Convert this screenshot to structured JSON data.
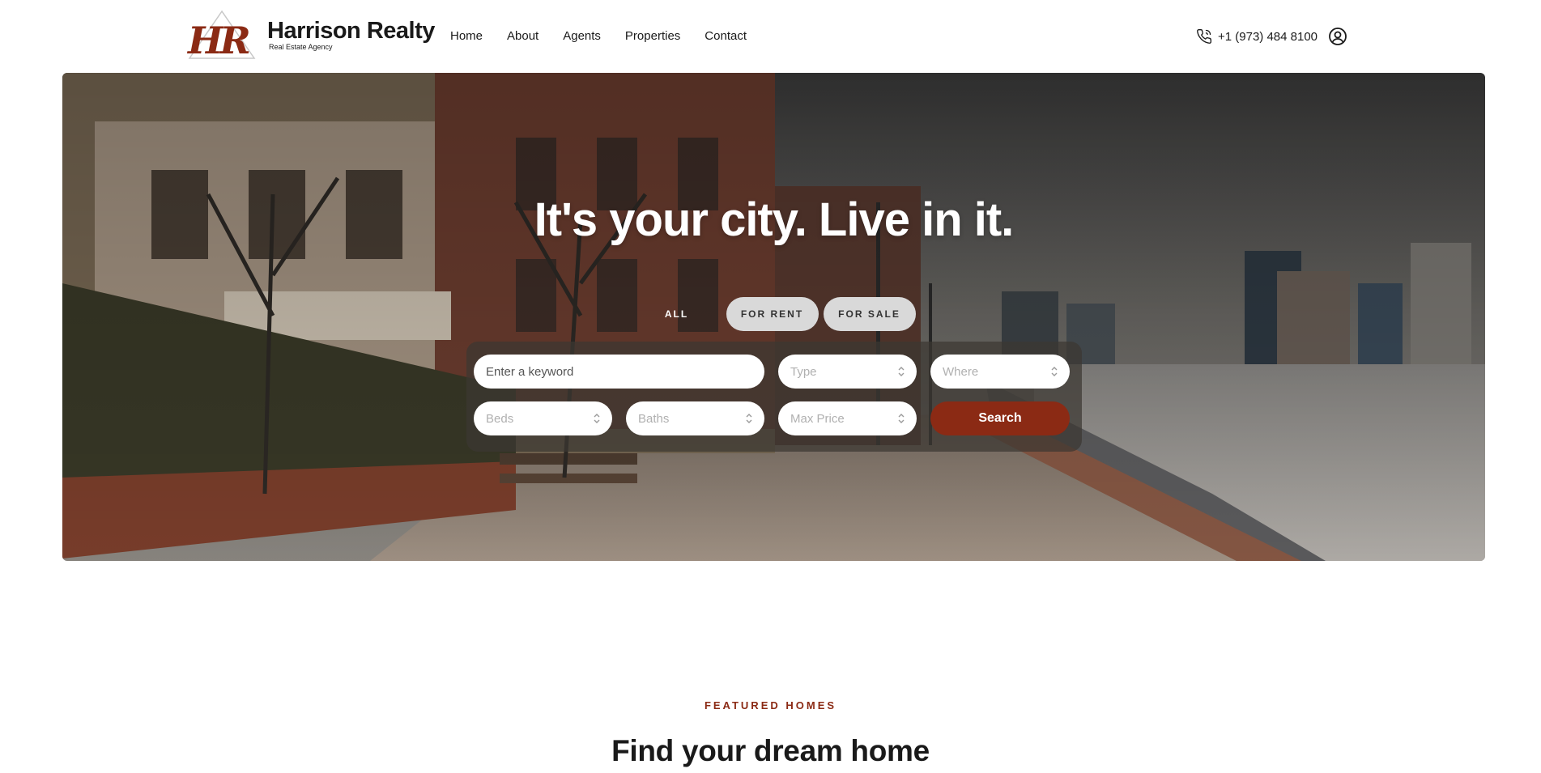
{
  "brand": {
    "logo_letters": "HR",
    "name": "Harrison Realty",
    "tagline": "Real Estate Agency",
    "accent_color": "#8b2a14"
  },
  "nav": {
    "items": [
      {
        "label": "Home"
      },
      {
        "label": "About"
      },
      {
        "label": "Agents"
      },
      {
        "label": "Properties"
      },
      {
        "label": "Contact"
      }
    ]
  },
  "header": {
    "phone": "+1 (973) 484 8100",
    "phone_icon": "phone-icon",
    "account_icon": "user-circle-icon"
  },
  "hero": {
    "title": "It's your city. Live in it.",
    "tabs": [
      {
        "label": "ALL",
        "active": true
      },
      {
        "label": "FOR RENT",
        "active": false
      },
      {
        "label": "FOR SALE",
        "active": false
      }
    ],
    "search": {
      "keyword_placeholder": "Enter a keyword",
      "type_placeholder": "Type",
      "where_placeholder": "Where",
      "beds_placeholder": "Beds",
      "baths_placeholder": "Baths",
      "max_price_placeholder": "Max Price",
      "search_label": "Search"
    }
  },
  "featured": {
    "eyebrow": "FEATURED HOMES",
    "title": "Find your dream home"
  }
}
